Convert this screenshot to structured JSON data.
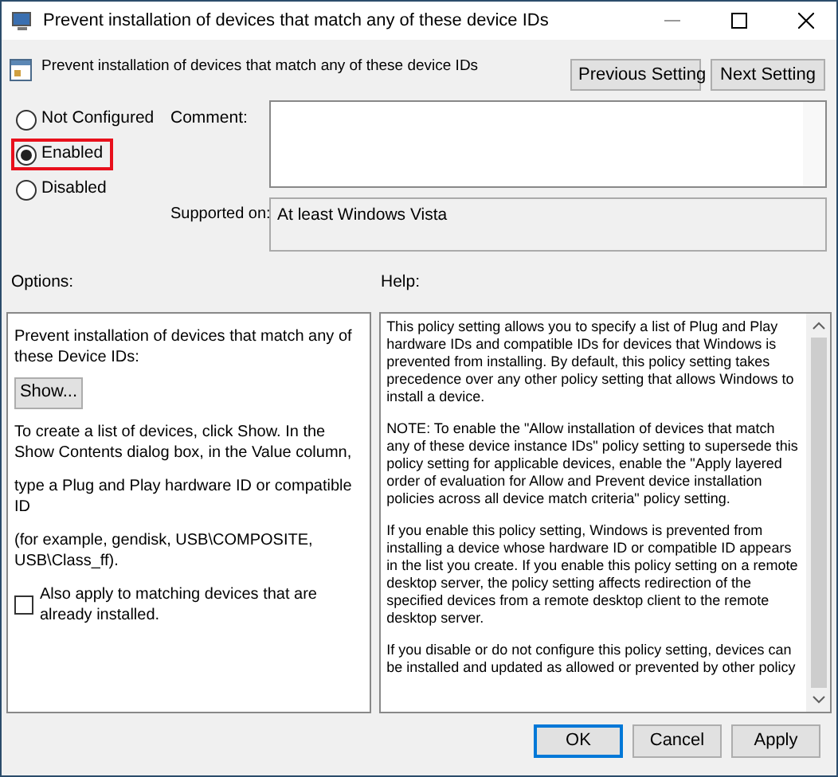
{
  "window": {
    "title": "Prevent installation of devices that match any of these device IDs"
  },
  "header": {
    "title": "Prevent installation of devices that match any of these device IDs",
    "buttons": [
      "Previous Setting",
      "Next Setting"
    ]
  },
  "states": [
    {
      "label": "Not Configured",
      "selected": false,
      "highlighted": false
    },
    {
      "label": "Enabled",
      "selected": true,
      "highlighted": true
    },
    {
      "label": "Disabled",
      "selected": false,
      "highlighted": false
    }
  ],
  "comment": {
    "label": "Comment:"
  },
  "supported_on": {
    "label": "Supported on:",
    "value": "At least Windows Vista"
  },
  "options": {
    "label": "Options:",
    "description": "Prevent installation of devices that match any of these Device IDs:",
    "show_button": "Show...",
    "paragraphs": [
      "To create a list of devices, click Show. In the Show Contents dialog box, in the Value column,",
      "type a Plug and Play hardware ID or compatible ID",
      "(for example, gendisk, USB\\COMPOSITE, USB\\Class_ff)."
    ],
    "checkbox": {
      "label": "Also apply to matching devices that are already installed.",
      "checked": false
    }
  },
  "help": {
    "label": "Help:",
    "paragraphs": [
      "This policy setting allows you to specify a list of Plug and Play hardware IDs and compatible IDs for devices that Windows is prevented from installing. By default, this policy setting takes precedence over any other policy setting that allows Windows to install a device.",
      "NOTE: To enable the \"Allow installation of devices that match any of these device instance IDs\" policy setting to supersede this policy setting for applicable devices, enable the \"Apply layered order of evaluation for Allow and Prevent device installation policies across all device match criteria\" policy setting.",
      "If you enable this policy setting, Windows is prevented from installing a device whose hardware ID or compatible ID appears in the list you create. If you enable this policy setting on a remote desktop server, the policy setting affects redirection of the specified devices from a remote desktop client to the remote desktop server.",
      "If you disable or do not configure this policy setting, devices can be installed and updated as allowed or prevented by other policy"
    ]
  },
  "buttons": [
    {
      "label": "OK",
      "default": true
    },
    {
      "label": "Cancel",
      "default": false
    },
    {
      "label": "Apply",
      "default": false
    }
  ]
}
